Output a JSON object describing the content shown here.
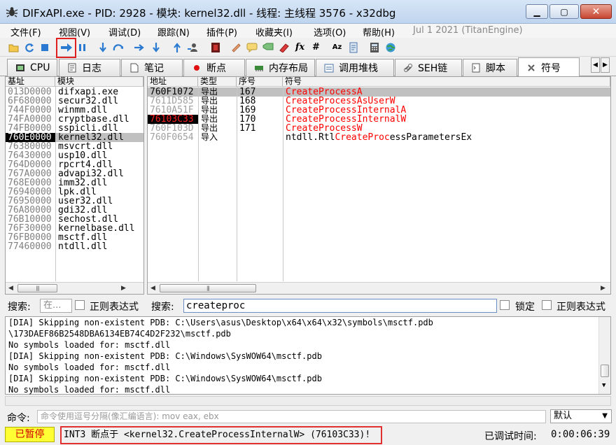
{
  "window": {
    "title": "DIFxAPI.exe - PID: 2928 - 模块: kernel32.dll - 线程: 主线程 3576 - x32dbg"
  },
  "menu": {
    "items": [
      "文件(F)",
      "视图(V)",
      "调试(D)",
      "跟踪(N)",
      "插件(P)",
      "收藏夹(I)",
      "选项(O)",
      "帮助(H)"
    ],
    "date": "Jul 1 2021 (TitanEngine)"
  },
  "toolbar": {
    "icons": [
      "open-icon",
      "restart-icon",
      "stop-icon",
      "run-icon",
      "pause-icon",
      "step-into-icon",
      "step-over-icon",
      "trace-into-icon",
      "trace-over-icon",
      "execute-till-return-icon",
      "run-to-user-code-icon",
      "scylla-icon",
      "patch-icon",
      "comment-icon",
      "label-icon",
      "bookmark-icon",
      "function-icon",
      "hash-icon",
      "font-icon",
      "script-icon",
      "calculator-icon",
      "globe-icon"
    ],
    "accent": "#e02020"
  },
  "tabs": [
    {
      "label": "CPU",
      "icon": "cpu-icon"
    },
    {
      "label": "日志",
      "icon": "log-icon"
    },
    {
      "label": "笔记",
      "icon": "notes-icon"
    },
    {
      "label": "断点",
      "icon": "breakpoint-icon"
    },
    {
      "label": "内存布局",
      "icon": "memory-icon"
    },
    {
      "label": "调用堆栈",
      "icon": "callstack-icon"
    },
    {
      "label": "SEH链",
      "icon": "seh-icon"
    },
    {
      "label": "脚本",
      "icon": "script-icon"
    },
    {
      "label": "符号",
      "icon": "symbol-icon"
    }
  ],
  "modules": {
    "headers": {
      "base": "基址",
      "module": "模块"
    },
    "rows": [
      {
        "base": "013D0000",
        "name": "difxapi.exe"
      },
      {
        "base": "6F680000",
        "name": "secur32.dll"
      },
      {
        "base": "744F0000",
        "name": "winmm.dll"
      },
      {
        "base": "74FA0000",
        "name": "cryptbase.dll"
      },
      {
        "base": "74FB0000",
        "name": "sspicli.dll"
      },
      {
        "base": "760E0000",
        "name": "kernel32.dll",
        "selected": true
      },
      {
        "base": "76380000",
        "name": "msvcrt.dll"
      },
      {
        "base": "76430000",
        "name": "usp10.dll"
      },
      {
        "base": "764D0000",
        "name": "rpcrt4.dll"
      },
      {
        "base": "767A0000",
        "name": "advapi32.dll"
      },
      {
        "base": "768E0000",
        "name": "imm32.dll"
      },
      {
        "base": "76940000",
        "name": "lpk.dll"
      },
      {
        "base": "76950000",
        "name": "user32.dll"
      },
      {
        "base": "76A80000",
        "name": "gdi32.dll"
      },
      {
        "base": "76B10000",
        "name": "sechost.dll"
      },
      {
        "base": "76F30000",
        "name": "kernelbase.dll"
      },
      {
        "base": "76FB0000",
        "name": "msctf.dll"
      },
      {
        "base": "77460000",
        "name": "ntdll.dll"
      }
    ]
  },
  "symbols": {
    "headers": {
      "address": "地址",
      "type": "类型",
      "ordinal": "序号",
      "symbol": "符号"
    },
    "rows": [
      {
        "address": "760F1072",
        "type": "导出",
        "ordinal": "167",
        "pre": "",
        "match": "CreateProc",
        "post": "essA",
        "color": "#ff0000",
        "addr_style": "selected"
      },
      {
        "address": "7611D585",
        "type": "导出",
        "ordinal": "168",
        "pre": "",
        "match": "CreateProc",
        "post": "essAsUserW",
        "color": "#ff0000",
        "addr_style": "gray"
      },
      {
        "address": "7610A51F",
        "type": "导出",
        "ordinal": "169",
        "pre": "",
        "match": "CreateProc",
        "post": "essInternalA",
        "color": "#ff0000",
        "addr_style": "gray"
      },
      {
        "address": "76103C33",
        "type": "导出",
        "ordinal": "170",
        "pre": "",
        "match": "CreateProc",
        "post": "essInternalW",
        "color": "#ff0000",
        "addr_style": "breakpoint"
      },
      {
        "address": "760F103D",
        "type": "导出",
        "ordinal": "171",
        "pre": "",
        "match": "CreateProc",
        "post": "essW",
        "color": "#ff0000",
        "addr_style": "gray"
      },
      {
        "address": "760F0654",
        "type": "导入",
        "ordinal": "",
        "pre": "ntdll.Rtl",
        "match": "CreateProc",
        "post": "essParametersEx",
        "color": "#000000",
        "addr_style": "gray"
      }
    ]
  },
  "search": {
    "label_left": "搜索:",
    "left_placeholder": "在...",
    "regex_left": "正则表达式",
    "label_right": "搜索:",
    "value": "createproc",
    "lock": "锁定",
    "regex_right": "正则表达式"
  },
  "log": {
    "lines": [
      "[DIA] Skipping non-existent PDB: C:\\Users\\asus\\Desktop\\x64\\x64\\x32\\symbols\\msctf.pdb",
      "\\173DAEF86B2548DBA6134EB74C4D2F232\\msctf.pdb",
      "No symbols loaded for: msctf.dll",
      "[DIA] Skipping non-existent PDB: C:\\Windows\\SysWOW64\\msctf.pdb",
      "No symbols loaded for: msctf.dll",
      "[DIA] Skipping non-existent PDB: C:\\Windows\\SysWOW64\\msctf.pdb",
      "No symbols loaded for: msctf.dll"
    ]
  },
  "command": {
    "label": "命令:",
    "placeholder": "命令使用逗号分隔(像汇编语言): mov eax, ebx",
    "mode": "默认"
  },
  "status": {
    "state": "已暂停",
    "message": "INT3 断点于 <kernel32.CreateProcessInternalW> (76103C33)!",
    "timer_label": "已调试时间:",
    "timer": "0:00:06:39"
  }
}
